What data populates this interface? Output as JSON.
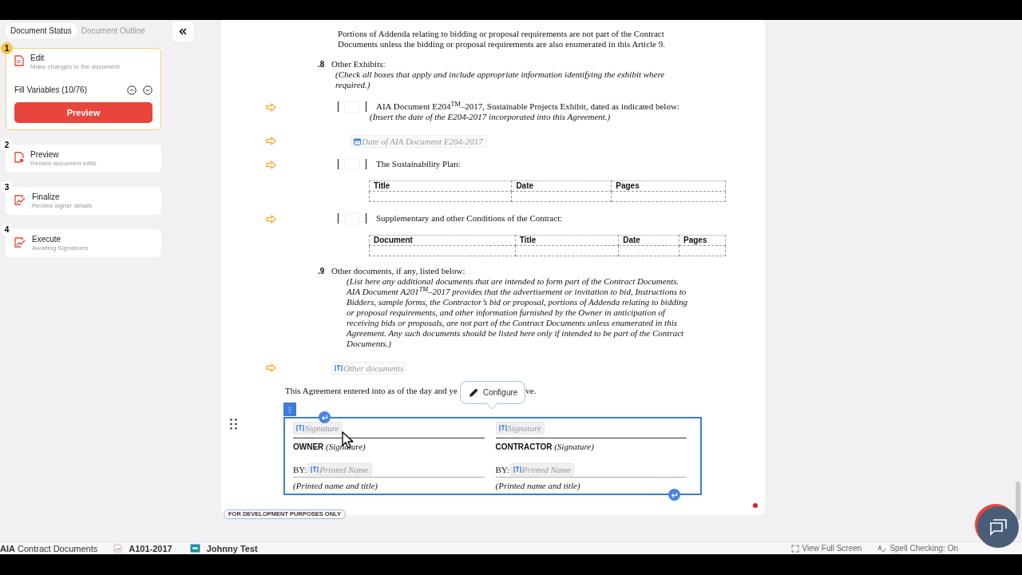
{
  "sidebar": {
    "tabs": [
      {
        "label": "Document Status",
        "selected": true
      },
      {
        "label": "Document Outline",
        "selected": false
      }
    ],
    "steps": [
      {
        "number": "1",
        "kind": "edit",
        "title": "Edit",
        "subtitle": "Make changes to the document",
        "active": true,
        "fill_label": "Fill Variables (10/76)",
        "button": "Preview"
      },
      {
        "number": "2",
        "kind": "preview",
        "title": "Preview",
        "subtitle": "Review document edits",
        "active": false
      },
      {
        "number": "3",
        "kind": "sign",
        "title": "Finalize",
        "subtitle": "Review signer details",
        "active": false
      },
      {
        "number": "4",
        "kind": "sign",
        "title": "Execute",
        "subtitle": "Awaiting Signatures",
        "active": false
      }
    ]
  },
  "document": {
    "blocks": [
      {
        "kind": "paragraph",
        "text": "Portions of Addenda relating to bidding or proposal requirements are not part of the Contract Documents unless the bidding or proposal requirements are also enumerated in this Article 9."
      },
      {
        "kind": "item",
        "number": ".8",
        "text": "Other Exhibits:",
        "note": "(Check all boxes that apply and include appropriate information identifying the exhibit where required.)"
      },
      {
        "kind": "checkbox",
        "checked": false,
        "text": "AIA Document E204$^{TM}$–2017, Sustainable Projects Exhibit, dated as indicated below:",
        "note": "(Insert the date of the E204-2017 incorporated into this Agreement.)"
      },
      {
        "kind": "date-variable",
        "text": "Date of AIA Document E204-2017"
      },
      {
        "kind": "checkbox",
        "checked": false,
        "text": "The Sustainability Plan:"
      },
      {
        "kind": "table",
        "columns": [
          "Title",
          "Date",
          "Pages"
        ]
      },
      {
        "kind": "checkbox",
        "checked": false,
        "text": "Supplementary and other Conditions of the Contract:"
      },
      {
        "kind": "table",
        "columns": [
          "Document",
          "Title",
          "Date",
          "Pages"
        ]
      },
      {
        "kind": "item",
        "number": ".9",
        "text": "Other documents, if any, listed below:",
        "note": "(List here any additional documents that are intended to form part of the Contract Documents. AIA Document A201$^{TM}$–2017 provides that the advertisement or invitation to bid, Instructions to Bidders, sample forms, the Contractor’s bid or proposal, portions of Addenda relating to bidding or proposal requirements, and other information furnished by the Owner in anticipation of receiving bids or proposals, are not part of the Contract Documents unless enumerated in this Agreement. Any such documents should be listed here only if intended to be part of the Contract Documents.)"
      },
      {
        "kind": "variable",
        "text": "Other documents"
      }
    ],
    "agreement": {
      "text_before": "This Agreement entered into as of the day and ye",
      "text_after": "ve.",
      "configure": "Configure"
    },
    "signature_columns": [
      {
        "signature_field": "Signature",
        "role": "OWNER",
        "role_note": "(Signature)",
        "by": "BY:",
        "name_field": "Printed Name",
        "caption": "(Printed name and title)"
      },
      {
        "signature_field": "Signature",
        "role": "CONTRACTOR",
        "role_note": "(Signature)",
        "by": "BY:",
        "name_field": "Printed Name",
        "caption": "(Printed name and title)"
      }
    ],
    "dev_badge": "FOR DEVELOPMENT PURPOSES ONLY"
  },
  "status_bar": {
    "brand": "**AIA** Contract Documents",
    "document": "A101-2017",
    "user": "Johnny Test",
    "full_screen": "View Full Screen",
    "spell_check": "Spell Checking: On"
  }
}
